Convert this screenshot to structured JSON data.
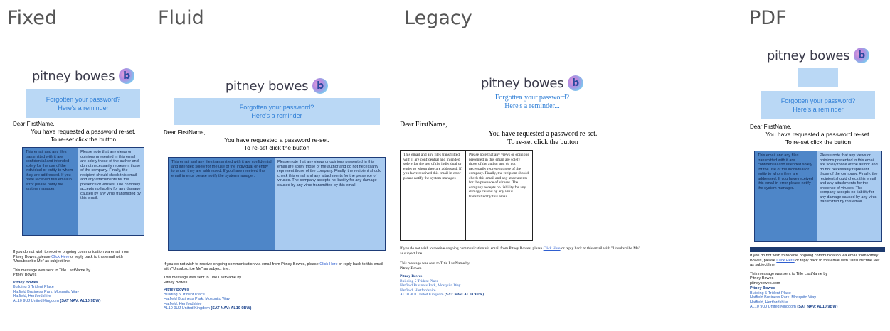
{
  "columns": [
    {
      "title": "Fixed"
    },
    {
      "title": "Fluid"
    },
    {
      "title": "Legacy"
    },
    {
      "title": "PDF"
    }
  ],
  "email": {
    "logo_text": "pitney bowes",
    "logo_mark": "b",
    "banner_line1": "Forgotten your password?",
    "banner_line2": "Here's a reminder",
    "legacy_banner_line2": "Here's a reminder...",
    "greeting": "Dear FirstName,",
    "notice_line1": "You have requested a password re-set.",
    "notice_line2": "To re-set click the button",
    "left_text": "This email and any files transmitted with it are confidential and intended solely for the use of the individual or entity to whom they are addressed. If you have received this email in error please notify the system manager.",
    "right_text": "Please note that any views or opinions presented in this email are solely those of the author and do not necessarily represent those of the company. Finally, the recipient should check this email and any attachments for the presence of viruses. The company accepts no liability for any damage caused by any virus transmitted by this email.",
    "unsub_pre": "If you do not wish to receive ongoing communication via email from Pitney Bowes, please",
    "unsub_link": "Click Here",
    "unsub_post": "or reply back to this email with \"Unsubscribe Me\" as subject line.",
    "sent_to": "This message was sent to Title LastName by",
    "sent_by": "Pitney Bowes",
    "website": "pitneybowes.com",
    "company_name": "Pitney Bowes",
    "address1": "Building 5 Trident Place",
    "address2": "Hatfield Business Park, Mosquito Way",
    "address3": "Hatfield, Hertfordshire",
    "address4_pre": "AL10 9UJ United Kingdom",
    "address4_bold": "(SAT NAV: AL10 9BW)"
  },
  "colors": {
    "banner_bg": "#bad8f5",
    "banner_text": "#2e7ed6",
    "box_left": "#4e86c8",
    "box_right": "#a9cbf0",
    "pdf_bar": "#1d3a6e"
  }
}
